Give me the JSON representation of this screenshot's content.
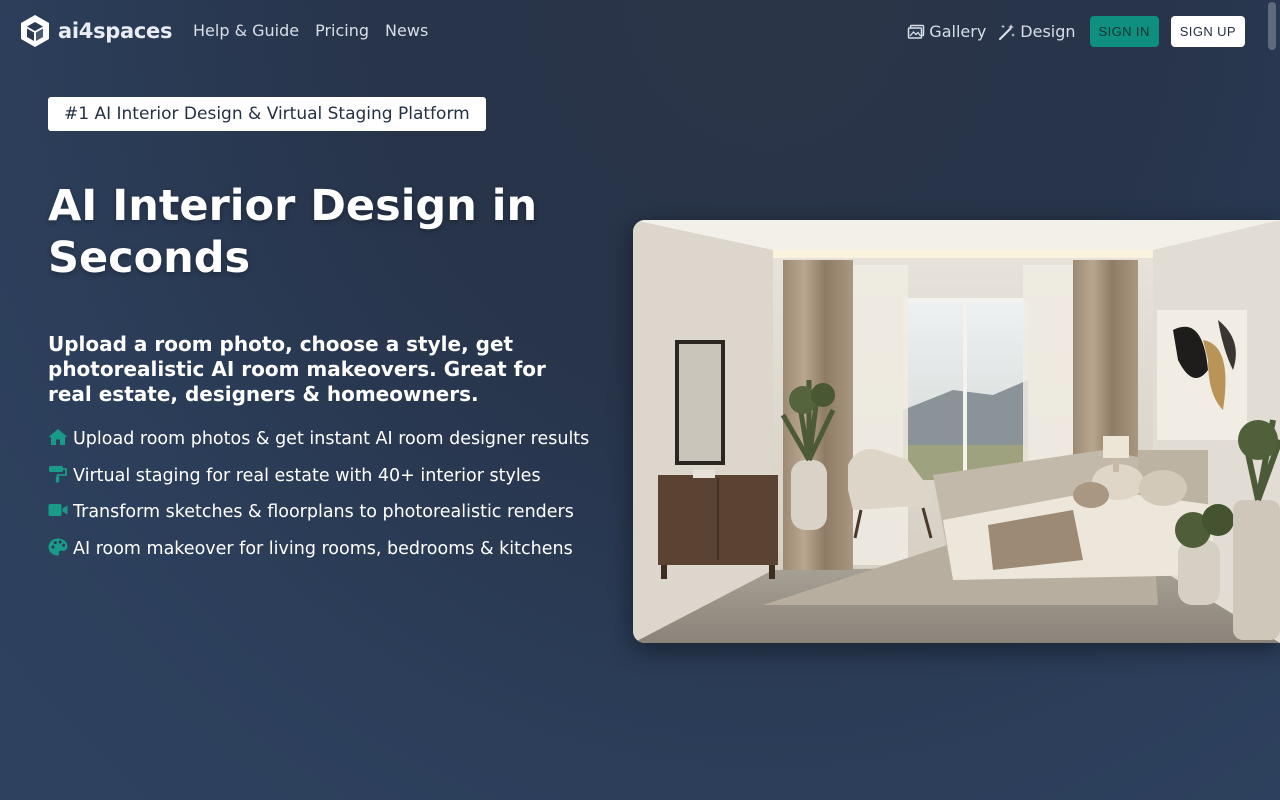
{
  "brand": {
    "name": "ai4spaces",
    "logo_icon": "cube-icon"
  },
  "nav": {
    "links": [
      "Help & Guide",
      "Pricing",
      "News"
    ],
    "gallery_label": "Gallery",
    "design_label": "Design",
    "signin_label": "SIGN IN",
    "signup_label": "SIGN UP"
  },
  "hero": {
    "badge": "#1 AI Interior Design & Virtual Staging Platform",
    "title": "AI Interior Design in Seconds",
    "subtitle": "Upload a room photo, choose a style, get photorealistic AI room makeovers. Great for real estate, designers & homeowners.",
    "features": [
      {
        "icon": "home-icon",
        "text": "Upload room photos & get instant AI room designer results"
      },
      {
        "icon": "paint-roller-icon",
        "text": "Virtual staging for real estate with 40+ interior styles"
      },
      {
        "icon": "video-camera-icon",
        "text": "Transform sketches & floorplans to photorealistic renders"
      },
      {
        "icon": "palette-icon",
        "text": "AI room makeover for living rooms, bedrooms & kitchens"
      }
    ]
  },
  "colors": {
    "accent": "#0f8f80",
    "feature_icon": "#1a9a88",
    "background": "#2a3a52"
  }
}
